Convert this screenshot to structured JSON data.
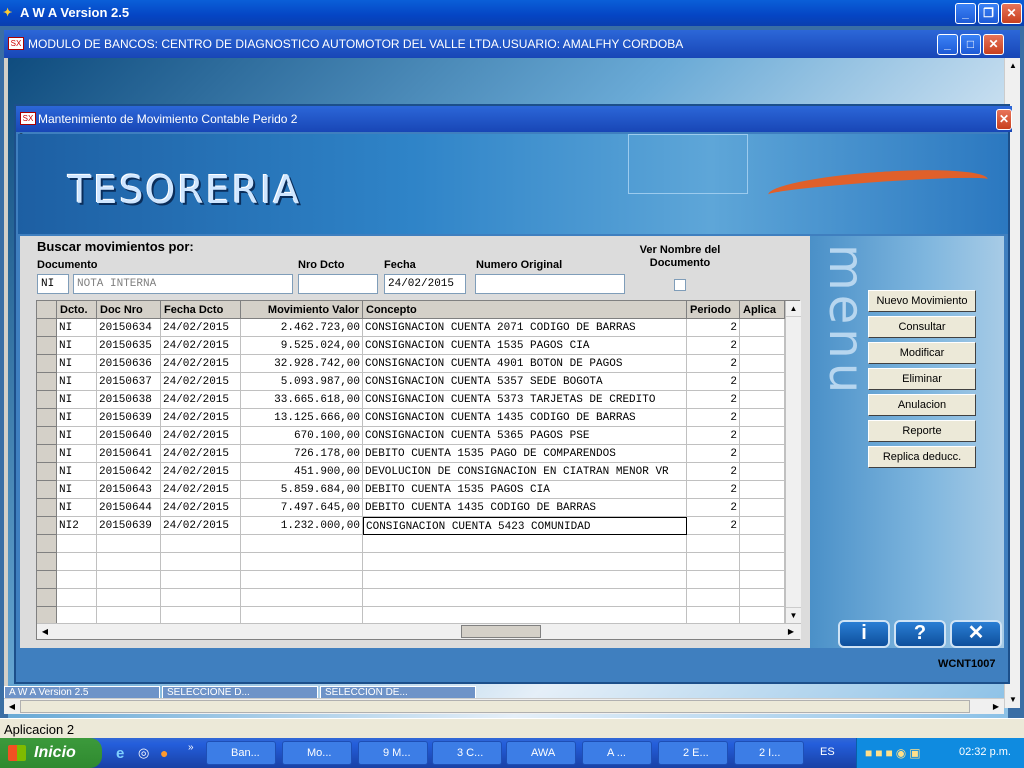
{
  "app": {
    "title": "A W A Version 2.5"
  },
  "module": {
    "title": "MODULO DE BANCOS: CENTRO DE DIAGNOSTICO AUTOMOTOR DEL VALLE LTDA.USUARIO: AMALFHY CORDOBA"
  },
  "dialog": {
    "title": "Mantenimiento de Movimiento Contable Perido 2",
    "corner_num": "2",
    "banner": "TESORERIA",
    "form_code": "WCNT1007"
  },
  "search": {
    "heading": "Buscar movimientos por:",
    "doc_label": "Documento",
    "doc_code": "NI",
    "doc_name": "NOTA INTERNA",
    "nro_label": "Nro Dcto",
    "nro_value": "",
    "fecha_label": "Fecha",
    "fecha_value": "24/02/2015",
    "orig_label": "Numero Original",
    "orig_value": "",
    "ver_label": "Ver Nombre del Documento"
  },
  "menu": {
    "word": "menu",
    "buttons": [
      "Nuevo Movimiento",
      "Consultar",
      "Modificar",
      "Eliminar",
      "Anulacion",
      "Reporte",
      "Replica deducc."
    ]
  },
  "grid": {
    "columns": [
      "Dcto.",
      "Doc Nro",
      "Fecha Dcto",
      "Movimiento Valor",
      "Concepto",
      "Periodo",
      "Aplica"
    ],
    "rows": [
      [
        "NI",
        "20150634",
        "24/02/2015",
        "2.462.723,00",
        "CONSIGNACION CUENTA 2071 CODIGO DE BARRAS",
        "2"
      ],
      [
        "NI",
        "20150635",
        "24/02/2015",
        "9.525.024,00",
        "CONSIGNACION CUENTA 1535 PAGOS CIA",
        "2"
      ],
      [
        "NI",
        "20150636",
        "24/02/2015",
        "32.928.742,00",
        "CONSIGNACION CUENTA 4901 BOTON DE PAGOS",
        "2"
      ],
      [
        "NI",
        "20150637",
        "24/02/2015",
        "5.093.987,00",
        "CONSIGNACION CUENTA 5357 SEDE BOGOTA",
        "2"
      ],
      [
        "NI",
        "20150638",
        "24/02/2015",
        "33.665.618,00",
        "CONSIGNACION CUENTA 5373 TARJETAS DE CREDITO",
        "2"
      ],
      [
        "NI",
        "20150639",
        "24/02/2015",
        "13.125.666,00",
        "CONSIGNACION CUENTA 1435 CODIGO DE BARRAS",
        "2"
      ],
      [
        "NI",
        "20150640",
        "24/02/2015",
        "670.100,00",
        "CONSIGNACION CUENTA 5365 PAGOS PSE",
        "2"
      ],
      [
        "NI",
        "20150641",
        "24/02/2015",
        "726.178,00",
        "DEBITO CUENTA 1535 PAGO DE COMPARENDOS",
        "2"
      ],
      [
        "NI",
        "20150642",
        "24/02/2015",
        "451.900,00",
        "DEVOLUCION DE CONSIGNACION EN CIATRAN MENOR VR",
        "2"
      ],
      [
        "NI",
        "20150643",
        "24/02/2015",
        "5.859.684,00",
        "DEBITO CUENTA 1535 PAGOS CIA",
        "2"
      ],
      [
        "NI",
        "20150644",
        "24/02/2015",
        "7.497.645,00",
        "DEBITO CUENTA 1435 CODIGO DE BARRAS",
        "2"
      ],
      [
        "NI2",
        "20150639",
        "24/02/2015",
        "1.232.000,00",
        "CONSIGNACION CUENTA 5423 COMUNIDAD",
        "2"
      ]
    ],
    "empty_rows": 5
  },
  "mdi_tabs": [
    "A W A Version 2.5",
    "SELECCIONE D...",
    "SELECCION DE..."
  ],
  "status": {
    "text": "Aplicacion 2"
  },
  "taskbar": {
    "start": "Inicio",
    "tasks": [
      "Ban...",
      "Mo...",
      "9 M...",
      "3 C...",
      "AWA",
      "A ...",
      "2 E...",
      "2 I..."
    ],
    "lang": "ES",
    "clock": "02:32 p.m."
  }
}
